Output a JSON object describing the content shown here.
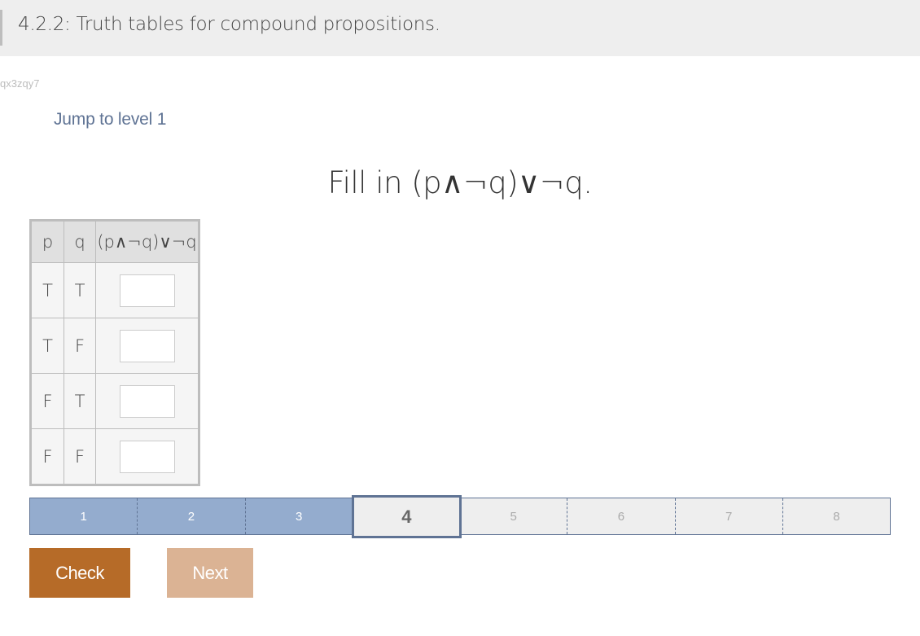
{
  "header": {
    "title": "4.2.2: Truth tables for compound propositions."
  },
  "activity_id": "qx3zqy7",
  "jump_link": "Jump to level 1",
  "prompt": "Fill in (p∧¬q)∨¬q.",
  "truth_table": {
    "headers": [
      "p",
      "q",
      "(p∧¬q)∨¬q"
    ],
    "rows": [
      {
        "p": "T",
        "q": "T",
        "answer": ""
      },
      {
        "p": "T",
        "q": "F",
        "answer": ""
      },
      {
        "p": "F",
        "q": "T",
        "answer": ""
      },
      {
        "p": "F",
        "q": "F",
        "answer": ""
      }
    ]
  },
  "progress": {
    "levels": [
      "1",
      "2",
      "3",
      "4",
      "5",
      "6",
      "7",
      "8"
    ],
    "completed": 3,
    "current": "4"
  },
  "buttons": {
    "check": "Check",
    "next": "Next"
  },
  "colors": {
    "check": "#b66b28",
    "next_disabled": "#dbb394",
    "progress_done": "#94acce",
    "accent": "#5f7394"
  }
}
